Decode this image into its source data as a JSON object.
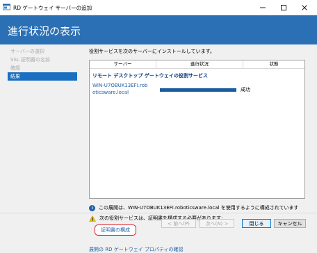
{
  "window": {
    "title": "RD ゲートウェイ サーバーの追加",
    "controls": [
      "minimize",
      "maximize",
      "close"
    ]
  },
  "header": {
    "heading": "進行状況の表示"
  },
  "sidebar": {
    "items": [
      {
        "label": "サーバーの選択",
        "active": false
      },
      {
        "label": "SSL 証明書の名前",
        "active": false
      },
      {
        "label": "確認",
        "active": false
      },
      {
        "label": "結果",
        "active": true
      }
    ]
  },
  "main": {
    "description": "役割サービスを次のサーバーにインストールしています。",
    "grid": {
      "columns": [
        "サーバー",
        "進行状況",
        "状態"
      ],
      "role_title": "リモート デスクトップ ゲートウェイの役割サービス",
      "rows": [
        {
          "server": "WIN-U7OBUK13EFI.roboticsware.local",
          "progress": 1.0,
          "status": "成功"
        }
      ]
    },
    "info_text": "この展開は、WIN-U7OBUK13EFI.roboticsware.local を使用するように構成されています",
    "warning_text": "次の役割サービスは、証明書を構成する必要があります:",
    "configure_cert_link": "証明書の構成",
    "properties_link": "展開の RD ゲートウェイ プロパティの確認"
  },
  "footer": {
    "prev": "< 前へ(P)",
    "next": "次へ(N) >",
    "close": "閉じる",
    "cancel": "キャンセル"
  },
  "colors": {
    "header": "#2b70b5",
    "accent": "#1a6fc0",
    "progress": "#1a5c9e",
    "highlight": "#e0141e"
  }
}
